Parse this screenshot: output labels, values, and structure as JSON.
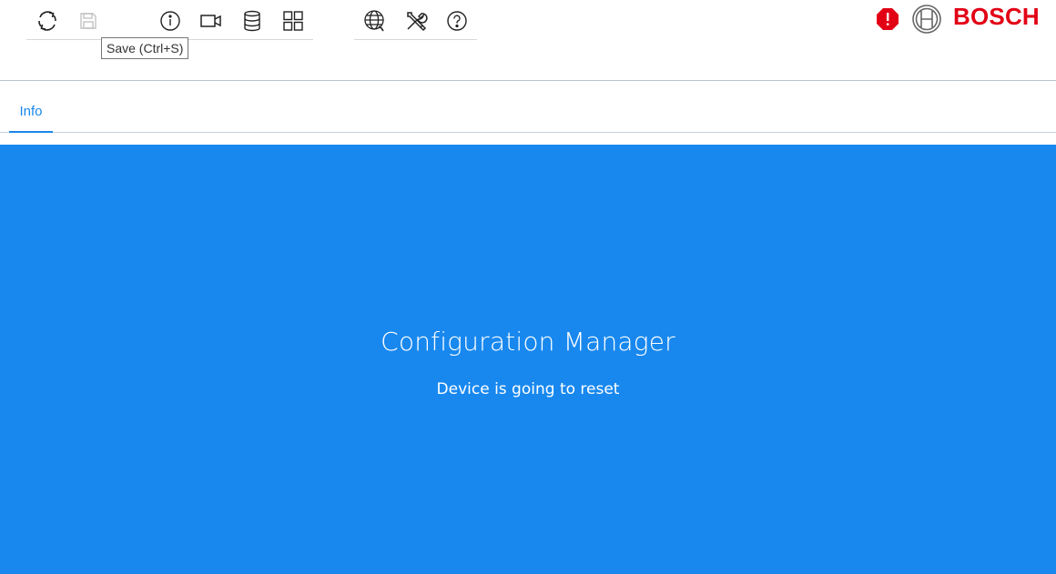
{
  "toolbar": {
    "buttons": [
      {
        "name": "reload-icon"
      },
      {
        "name": "save-icon",
        "disabled": true
      },
      {
        "name": "info-icon"
      },
      {
        "name": "video-camera-icon"
      },
      {
        "name": "database-icon"
      },
      {
        "name": "grid-view-icon"
      },
      {
        "name": "network-globe-icon"
      },
      {
        "name": "tools-icon"
      },
      {
        "name": "help-icon"
      }
    ],
    "tooltip": "Save (Ctrl+S)"
  },
  "brand": {
    "logo_text": "BOSCH",
    "alert_color": "#e20015",
    "brand_color": "#e20015"
  },
  "tabs": [
    {
      "label": "Info",
      "active": true
    }
  ],
  "main": {
    "title": "Configuration Manager",
    "status": "Device is going to reset",
    "background": "#1888ef"
  },
  "colors": {
    "accent": "#1a88ea"
  }
}
